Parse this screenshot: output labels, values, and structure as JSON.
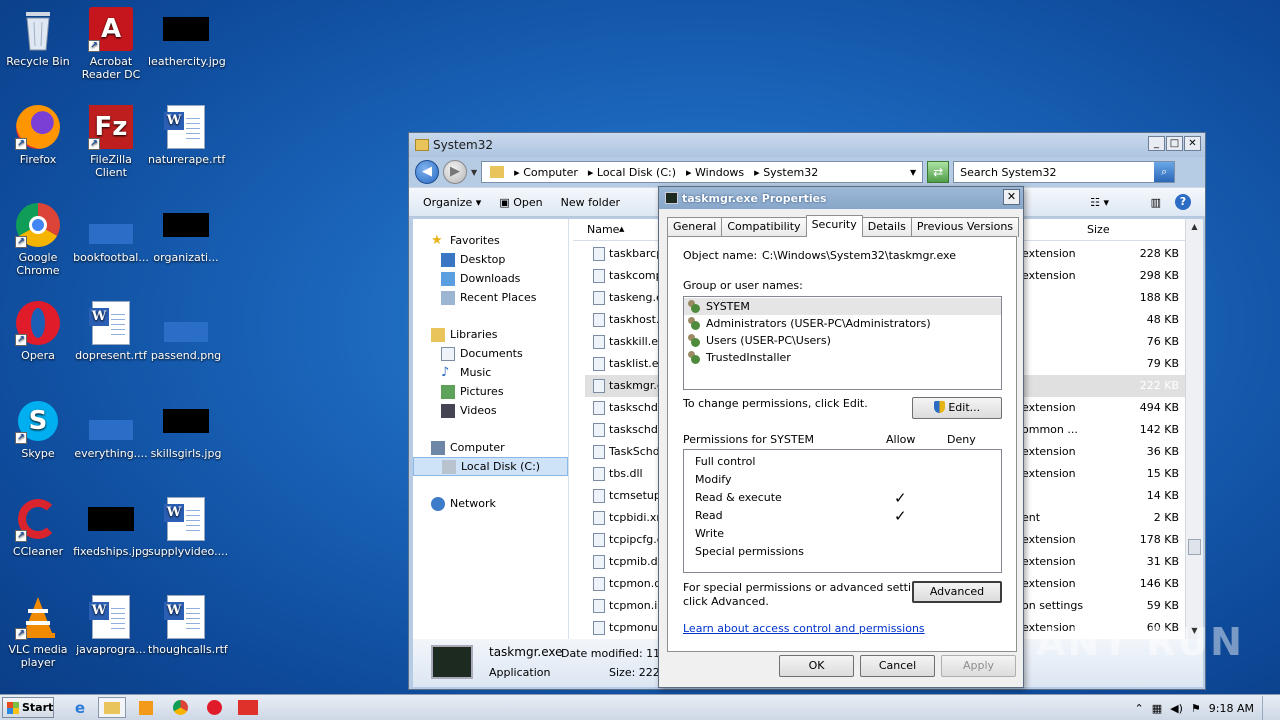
{
  "desktop_icons": [
    {
      "label": "Recycle Bin",
      "icon": "recycle-bin-icon"
    },
    {
      "label": "Acrobat Reader DC",
      "icon": "acrobat-icon"
    },
    {
      "label": "leathercity.jpg",
      "icon": "image-thumb-icon"
    },
    {
      "label": "Firefox",
      "icon": "firefox-icon"
    },
    {
      "label": "FileZilla Client",
      "icon": "filezilla-icon"
    },
    {
      "label": "naturerape.rtf",
      "icon": "word-doc-icon"
    },
    {
      "label": "Google Chrome",
      "icon": "chrome-icon"
    },
    {
      "label": "bookfootbal...",
      "icon": "file-icon"
    },
    {
      "label": "organizati...",
      "icon": "image-thumb-icon"
    },
    {
      "label": "Opera",
      "icon": "opera-icon"
    },
    {
      "label": "dopresent.rtf",
      "icon": "word-doc-icon"
    },
    {
      "label": "passend.png",
      "icon": "file-icon"
    },
    {
      "label": "Skype",
      "icon": "skype-icon"
    },
    {
      "label": "everything....",
      "icon": "file-icon"
    },
    {
      "label": "skillsgirls.jpg",
      "icon": "image-thumb-icon"
    },
    {
      "label": "CCleaner",
      "icon": "ccleaner-icon"
    },
    {
      "label": "fixedships.jpg",
      "icon": "image-thumb-icon"
    },
    {
      "label": "supplyvideo....",
      "icon": "word-doc-icon"
    },
    {
      "label": "VLC media player",
      "icon": "vlc-icon"
    },
    {
      "label": "javaprogra...",
      "icon": "word-doc-icon"
    },
    {
      "label": "thoughcalls.rtf",
      "icon": "word-doc-icon"
    }
  ],
  "explorer": {
    "title": "System32",
    "breadcrumb": [
      "Computer",
      "Local Disk (C:)",
      "Windows",
      "System32"
    ],
    "search_placeholder": "Search System32",
    "toolbar": {
      "organize": "Organize",
      "open": "Open",
      "new_folder": "New folder"
    },
    "nav": {
      "favorites": "Favorites",
      "desktop": "Desktop",
      "downloads": "Downloads",
      "recent": "Recent Places",
      "libraries": "Libraries",
      "documents": "Documents",
      "music": "Music",
      "pictures": "Pictures",
      "videos": "Videos",
      "computer": "Computer",
      "local_disk": "Local Disk (C:)",
      "network": "Network"
    },
    "columns": {
      "name": "Name",
      "size": "Size"
    },
    "files": [
      {
        "name": "taskbarcpl",
        "type": "extension",
        "size": "228 KB"
      },
      {
        "name": "taskcomp.",
        "type": "extension",
        "size": "298 KB"
      },
      {
        "name": "taskeng.e",
        "type": "",
        "size": "188 KB"
      },
      {
        "name": "taskhost.e",
        "type": "",
        "size": "48 KB"
      },
      {
        "name": "taskkill.exe",
        "type": "",
        "size": "76 KB"
      },
      {
        "name": "tasklist.ex",
        "type": "",
        "size": "79 KB"
      },
      {
        "name": "taskmgr.e",
        "type": "",
        "size": "222 KB"
      },
      {
        "name": "taskschd.c",
        "type": "extension",
        "size": "494 KB"
      },
      {
        "name": "taskschd.r",
        "type": "ommon ...",
        "size": "142 KB"
      },
      {
        "name": "TaskSchdP",
        "type": "extension",
        "size": "36 KB"
      },
      {
        "name": "tbs.dll",
        "type": "extension",
        "size": "15 KB"
      },
      {
        "name": "tcmsetup.",
        "type": "",
        "size": "14 KB"
      },
      {
        "name": "tcpbidi.xm",
        "type": "ent",
        "size": "2 KB"
      },
      {
        "name": "tcpipcfg.dl",
        "type": "extension",
        "size": "178 KB"
      },
      {
        "name": "tcpmib.dll",
        "type": "extension",
        "size": "31 KB"
      },
      {
        "name": "tcpmon.dll",
        "type": "extension",
        "size": "146 KB"
      },
      {
        "name": "tcpmon.ini",
        "type": "on settings",
        "size": "59 KB"
      },
      {
        "name": "tcpmonui.",
        "type": "extension",
        "size": "60 KB"
      }
    ],
    "details": {
      "name": "taskmgr.exe",
      "date_modified": "Date modified: 11/2",
      "type": "Application",
      "size": "Size: 222 K"
    }
  },
  "dialog": {
    "title": "taskmgr.exe Properties",
    "tabs": [
      "General",
      "Compatibility",
      "Security",
      "Details",
      "Previous Versions"
    ],
    "object_name_label": "Object name:",
    "object_name_value": "C:\\Windows\\System32\\taskmgr.exe",
    "group_label": "Group or user names:",
    "users": [
      "SYSTEM",
      "Administrators (USER-PC\\Administrators)",
      "Users (USER-PC\\Users)",
      "TrustedInstaller"
    ],
    "change_text": "To change permissions, click Edit.",
    "edit_button": "Edit...",
    "permissions_for": "Permissions for SYSTEM",
    "allow": "Allow",
    "deny": "Deny",
    "permissions": [
      {
        "name": "Full control",
        "allow": ""
      },
      {
        "name": "Modify",
        "allow": ""
      },
      {
        "name": "Read & execute",
        "allow": "✓"
      },
      {
        "name": "Read",
        "allow": "✓"
      },
      {
        "name": "Write",
        "allow": ""
      },
      {
        "name": "Special permissions",
        "allow": ""
      }
    ],
    "special_text_1": "For special permissions or advanced settings,",
    "special_text_2": "click Advanced.",
    "advanced_button": "Advanced",
    "learn_link": "Learn about access control and permissions",
    "ok": "OK",
    "cancel": "Cancel",
    "apply": "Apply"
  },
  "taskbar": {
    "start": "Start",
    "time": "9:18 AM"
  },
  "watermark": "ANY RUN"
}
